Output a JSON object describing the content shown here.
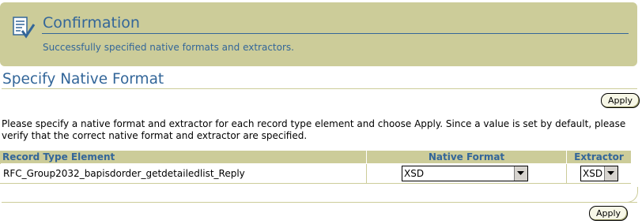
{
  "confirmation": {
    "title": "Confirmation",
    "message": "Successfully specified native formats and extractors.",
    "icon": "document-check-icon"
  },
  "page": {
    "title": "Specify Native Format",
    "instructions": "Please specify a native format and extractor for each record type element and choose Apply. Since a value is set by default, please verify that the correct native format and extractor are specified."
  },
  "buttons": {
    "apply_top": "Apply",
    "apply_bottom": "Apply"
  },
  "table": {
    "headers": {
      "record_type": "Record Type Element",
      "native_format": "Native Format",
      "extractor": "Extractor"
    },
    "rows": [
      {
        "record_type": "RFC_Group2032_bapisdorder_getdetailedlist_Reply",
        "native_format": "XSD",
        "extractor": "XSD"
      }
    ]
  },
  "colors": {
    "accent": "#336699",
    "panel": "#cccc99"
  }
}
